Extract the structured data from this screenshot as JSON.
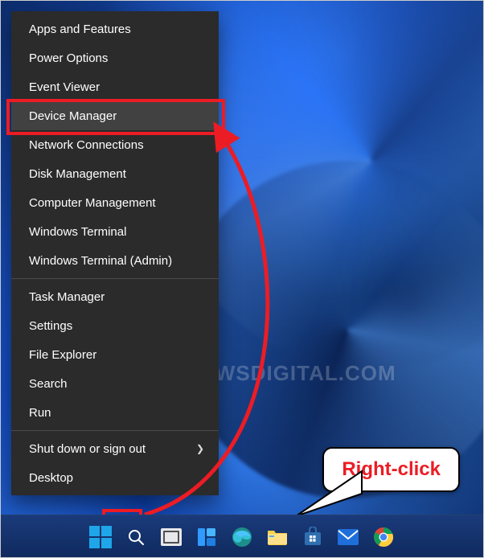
{
  "menu": {
    "items": [
      "Apps and Features",
      "Power Options",
      "Event Viewer",
      "Device Manager",
      "Network Connections",
      "Disk Management",
      "Computer Management",
      "Windows Terminal",
      "Windows Terminal (Admin)"
    ],
    "items2": [
      "Task Manager",
      "Settings",
      "File Explorer",
      "Search",
      "Run"
    ],
    "items3": [
      "Shut down or sign out",
      "Desktop"
    ],
    "hovered_index": 3,
    "submenu_index_in_items3": 0
  },
  "callout": {
    "text": "Right-click"
  },
  "watermark": {
    "text": "WINDOWSDIGITAL.COM"
  },
  "colors": {
    "highlight": "#ec1c24",
    "menu_bg": "#2b2b2b"
  },
  "taskbar": {
    "icons": [
      "start",
      "search",
      "task-view",
      "widgets",
      "edge",
      "file-explorer",
      "microsoft-store",
      "mail",
      "chrome"
    ]
  }
}
